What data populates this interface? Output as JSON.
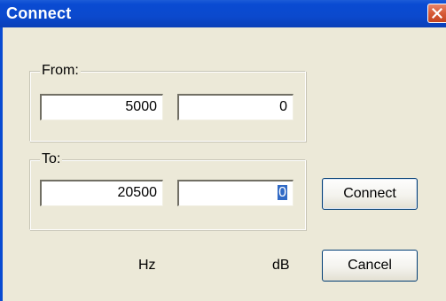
{
  "window": {
    "title": "Connect"
  },
  "from": {
    "label": "From:",
    "freq": "5000",
    "level": "0"
  },
  "to": {
    "label": "To:",
    "freq": "20500",
    "level": "0"
  },
  "units": {
    "freq": "Hz",
    "level": "dB"
  },
  "buttons": {
    "connect": "Connect",
    "cancel": "Cancel"
  },
  "colors": {
    "titlebar": "#0a4bd2",
    "dialog_bg": "#ece9d8",
    "selection": "#316ac5",
    "close_button": "#d65a36"
  },
  "icons": {
    "close": "close-x-icon"
  }
}
